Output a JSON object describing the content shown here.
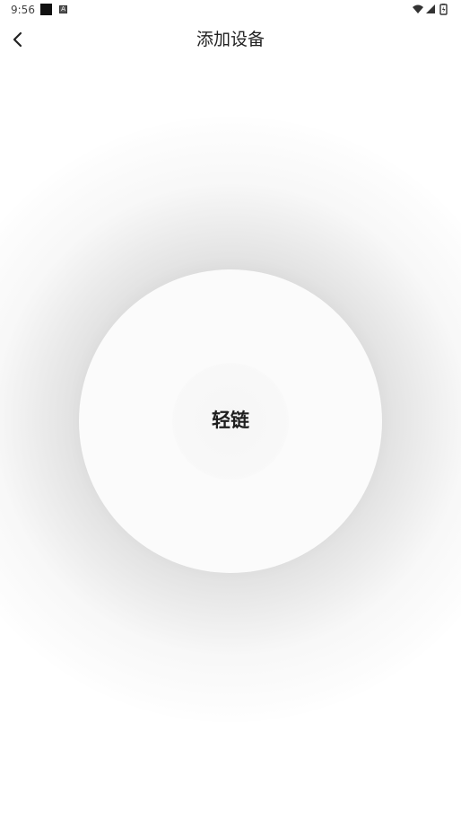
{
  "status_bar": {
    "time": "9:56",
    "icons": [
      "notification-square-icon",
      "a-badge-icon",
      "wifi-icon",
      "signal-icon",
      "battery-icon"
    ]
  },
  "header": {
    "title": "添加设备",
    "back_icon": "chevron-left-icon"
  },
  "main": {
    "pair_button_label": "轻链"
  },
  "colors": {
    "background": "#ffffff",
    "circle": "#fbfbfb",
    "title_text": "#222222",
    "label_text": "#1e1e1e"
  }
}
